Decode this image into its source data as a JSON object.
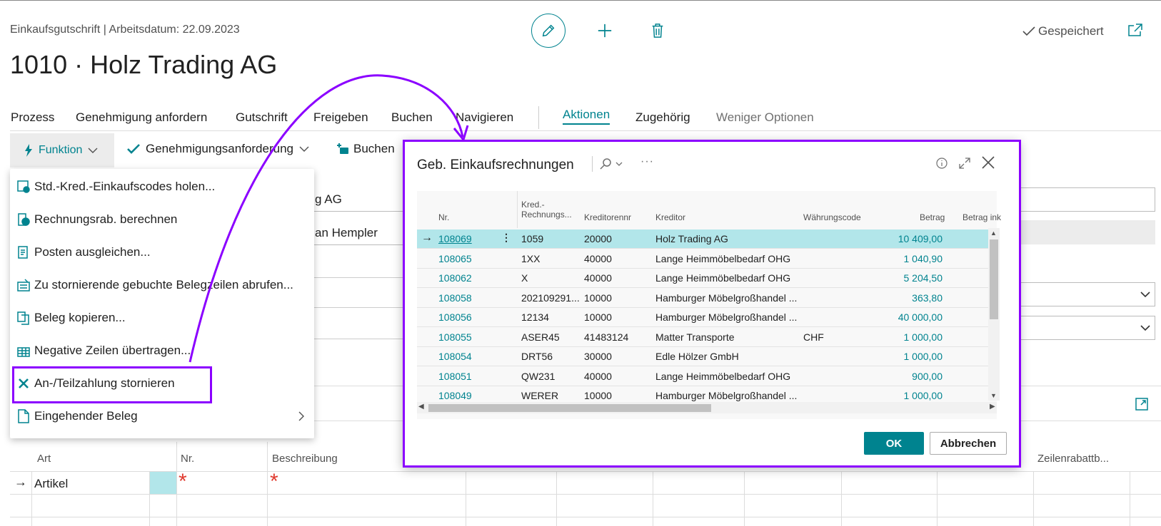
{
  "header": {
    "breadcrumb": "Einkaufsgutschrift | Arbeitsdatum: 22.09.2023",
    "title": "1010 · Holz Trading AG",
    "saved_label": "Gespeichert"
  },
  "menubar": {
    "items": [
      "Prozess",
      "Genehmigung anfordern",
      "Gutschrift",
      "Freigeben",
      "Buchen",
      "Navigieren"
    ],
    "actions": "Aktionen",
    "related": "Zugehörig",
    "fewer": "Weniger Optionen"
  },
  "actionbar": {
    "funktion": "Funktion",
    "approval": "Genehmigungsanforderung",
    "post": "Buchen"
  },
  "dropdown": {
    "items": [
      "Std.-Kred.-Einkaufscodes holen...",
      "Rechnungsrab. berechnen",
      "Posten ausgleichen...",
      "Zu stornierende gebuchte Belegzeilen abrufen...",
      "Beleg kopieren...",
      "Negative Zeilen übertragen...",
      "An-/Teilzahlung stornieren",
      "Eingehender Beleg"
    ]
  },
  "background_fields": {
    "name_value": "g AG",
    "contact_value": "an Hempler"
  },
  "dialog": {
    "title": "Geb. Einkaufsrechnungen",
    "columns": {
      "nr": "Nr.",
      "kred_line1": "Kred.-",
      "kred_line2": "Rechnungs...",
      "kreditorennr": "Kreditorennr",
      "kreditor": "Kreditor",
      "waehrung": "Währungscode",
      "betrag": "Betrag",
      "betrag_inkl": "Betrag ink"
    },
    "rows": [
      {
        "nr": "108069",
        "kred": "1059",
        "kredno": "20000",
        "kreditor": "Holz Trading AG",
        "cur": "",
        "amt": "10 409,00"
      },
      {
        "nr": "108065",
        "kred": "1XX",
        "kredno": "40000",
        "kreditor": "Lange Heimmöbelbedarf OHG",
        "cur": "",
        "amt": "1 040,90"
      },
      {
        "nr": "108062",
        "kred": "X",
        "kredno": "40000",
        "kreditor": "Lange Heimmöbelbedarf OHG",
        "cur": "",
        "amt": "5 204,50"
      },
      {
        "nr": "108058",
        "kred": "202109291...",
        "kredno": "10000",
        "kreditor": "Hamburger Möbelgroßhandel ...",
        "cur": "",
        "amt": "363,80"
      },
      {
        "nr": "108056",
        "kred": "12134",
        "kredno": "10000",
        "kreditor": "Hamburger Möbelgroßhandel ...",
        "cur": "",
        "amt": "40 000,00"
      },
      {
        "nr": "108055",
        "kred": "ASER45",
        "kredno": "41483124",
        "kreditor": "Matter Transporte",
        "cur": "CHF",
        "amt": "1 000,00"
      },
      {
        "nr": "108054",
        "kred": "DRT56",
        "kredno": "30000",
        "kreditor": "Edle Hölzer GmbH",
        "cur": "",
        "amt": "1 000,00"
      },
      {
        "nr": "108051",
        "kred": "QW231",
        "kredno": "40000",
        "kreditor": "Lange Heimmöbelbedarf OHG",
        "cur": "",
        "amt": "900,00"
      },
      {
        "nr": "108049",
        "kred": "WERER",
        "kredno": "10000",
        "kreditor": "Hamburger Möbelgroßhandel ...",
        "cur": "",
        "amt": "1 000,00"
      }
    ],
    "ok": "OK",
    "cancel": "Abbrechen"
  },
  "lines": {
    "col_art": "Art",
    "col_nr": "Nr.",
    "col_desc": "Beschreibung",
    "col_discount": "Zeilenrabattb...",
    "row1_art": "Artikel",
    "required_mark": "*"
  },
  "colors": {
    "accent": "#00838f",
    "highlight": "#8b00ff",
    "selected_row": "#b2e6ea",
    "required": "#e03a2f"
  }
}
